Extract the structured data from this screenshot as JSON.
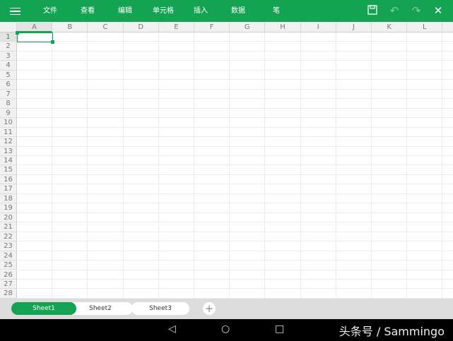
{
  "toolbar": {
    "menus": [
      "文件",
      "查看",
      "编辑",
      "单元格",
      "插入",
      "数据",
      "笔"
    ],
    "icons": [
      "menu-icon",
      "save-icon",
      "undo-icon",
      "redo-icon",
      "close-icon"
    ]
  },
  "grid": {
    "columns": [
      "A",
      "B",
      "C",
      "D",
      "E",
      "F",
      "G",
      "H",
      "I",
      "J",
      "K",
      "L"
    ],
    "rows": [
      "1",
      "2",
      "3",
      "4",
      "5",
      "6",
      "7",
      "8",
      "9",
      "10",
      "11",
      "12",
      "13",
      "14",
      "15",
      "16",
      "17",
      "18",
      "19",
      "20",
      "21",
      "22",
      "23",
      "24",
      "25",
      "26",
      "27",
      "28"
    ],
    "selected_cell": "A1"
  },
  "sheets": {
    "tabs": [
      "Sheet1",
      "Sheet2",
      "Sheet3"
    ],
    "active": "Sheet1",
    "add_label": "+"
  },
  "nav": {
    "back": "◁",
    "home": "○",
    "recent": "□",
    "watermark": "头条号 / Sammingo"
  },
  "colors": {
    "accent": "#14a352"
  }
}
